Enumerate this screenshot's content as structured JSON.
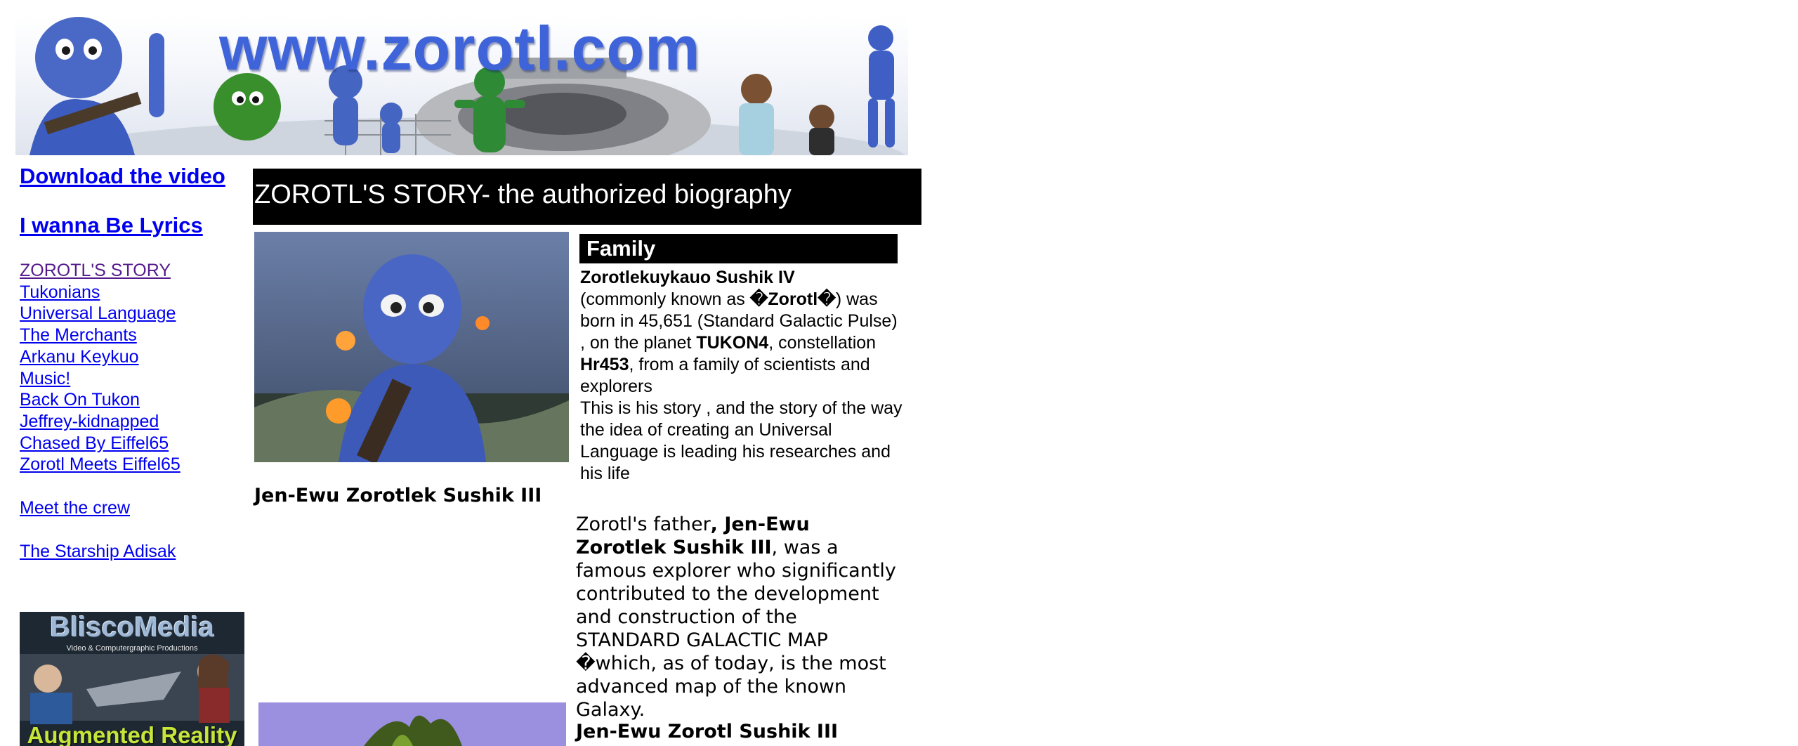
{
  "banner": {
    "text": "www.zorotl.com"
  },
  "nav": {
    "download_video": "Download the video",
    "lyrics": "I wanna Be Lyrics",
    "story_links": [
      "ZOROTL'S STORY",
      "Tukonians",
      "Universal Language",
      "The Merchants",
      "Arkanu Keykuo",
      "Music!",
      "Back On Tukon",
      "Jeffrey-kidnapped",
      "Chased By Eiffel65",
      "Zorotl Meets Eiffel65"
    ],
    "meet_crew": "Meet the crew",
    "starship": "The Starship Adisak"
  },
  "ad": {
    "title": "BliscoMedia",
    "subtitle": "Video & Computergraphic Productions",
    "footer": "Augmented Reality"
  },
  "main": {
    "title": "ZOROTL'S STORY- the authorized biography",
    "family_heading": "Family",
    "family_name": "Zorotlekuykauo Sushik IV",
    "family_p1_a": "(commonly known as ",
    "family_known_as": "�Zorotl�",
    "family_p1_b": ") was born in 45,651 (Standard Galactic Pulse) , on the planet ",
    "family_planet": "TUKON4",
    "family_p1_c": ", constellation ",
    "family_constellation": "Hr453",
    "family_p1_d": ",  from a family of scientists and explorers",
    "family_p2": "This is his story , and the story of the way the idea of creating an Universal Language is leading his researches and his life",
    "caption1": "Jen-Ewu Zorotlek Sushik III",
    "father_a": "Zorotl's father",
    "father_name": ", Jen-Ewu Zorotlek Sushik III",
    "father_b": ", was a famous explorer who significantly contributed to the development and construction of the STANDARD GALACTIC MAP �which, as  of today, is the most advanced map of the known Galaxy.",
    "caption2": "Jen-Ewu Zorotl Sushik III"
  }
}
